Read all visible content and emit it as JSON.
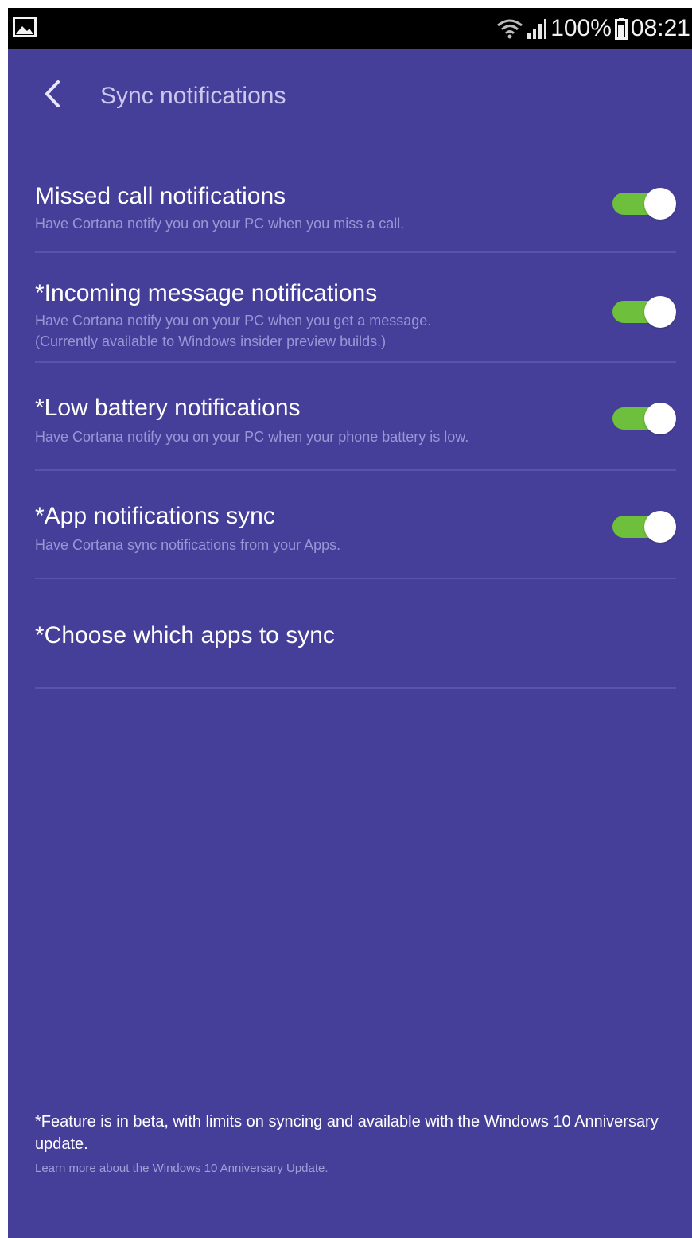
{
  "status_bar": {
    "battery_percent": "100%",
    "time": "08:21",
    "left_icon": "image-icon",
    "right_icons": [
      "wifi-icon",
      "signal-icon",
      "battery-icon"
    ]
  },
  "header": {
    "back_icon": "chevron-left-icon",
    "title": "Sync notifications"
  },
  "settings": [
    {
      "title": "Missed call notifications",
      "description": [
        "Have Cortana notify you on your PC when you miss a call."
      ],
      "toggle_on": true
    },
    {
      "title": "*Incoming message notifications",
      "description": [
        "Have Cortana notify you on your PC when you get a message.",
        "(Currently available to Windows insider preview builds.)"
      ],
      "toggle_on": true
    },
    {
      "title": "*Low battery notifications",
      "description": [
        "Have Cortana notify you on your PC when your phone battery is low."
      ],
      "toggle_on": true
    },
    {
      "title": "*App notifications sync",
      "description": [
        "Have Cortana sync notifications from your Apps."
      ],
      "toggle_on": true
    },
    {
      "title": "*Choose which apps to sync"
    }
  ],
  "footer": {
    "note": "*Feature is in beta, with limits on syncing and available with the Windows 10 Anniversary update.",
    "link": "Learn more about the Windows 10 Anniversary Update."
  },
  "colors": {
    "background": "#463f99",
    "status_bar": "#000000",
    "toggle_on": "#6dbf3c",
    "divider": "#5a53ab",
    "secondary_text": "#9a96d6"
  }
}
